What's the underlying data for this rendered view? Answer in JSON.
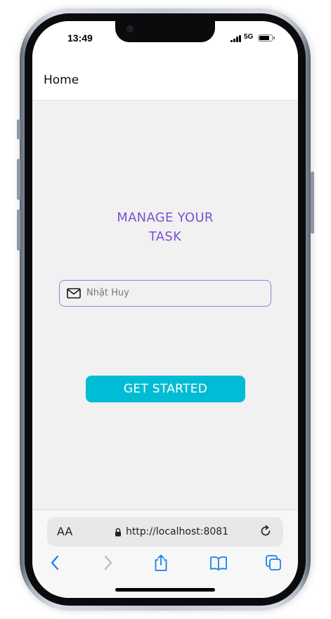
{
  "status_bar": {
    "time": "13:49",
    "network": "5G",
    "signal_bars": 4,
    "battery_level": 0.85
  },
  "header": {
    "title": "Home"
  },
  "main": {
    "headline_line1": "MANAGE YOUR",
    "headline_line2": "TASK",
    "name_field": {
      "icon": "mail-icon",
      "value": "",
      "placeholder": "Nhật Huy"
    },
    "cta_label": "GET STARTED"
  },
  "browser": {
    "text_size_label": "AA",
    "url": "http://localhost:8081",
    "icons": [
      "lock-icon",
      "reload-icon",
      "back-icon",
      "forward-icon",
      "share-icon",
      "bookmarks-icon",
      "tabs-icon"
    ]
  },
  "colors": {
    "accent_purple": "#7b52d0",
    "field_border": "#9a7ad6",
    "button_cyan": "#00bcd4",
    "ios_blue": "#1a82e8",
    "background": "#f1f1f1"
  }
}
